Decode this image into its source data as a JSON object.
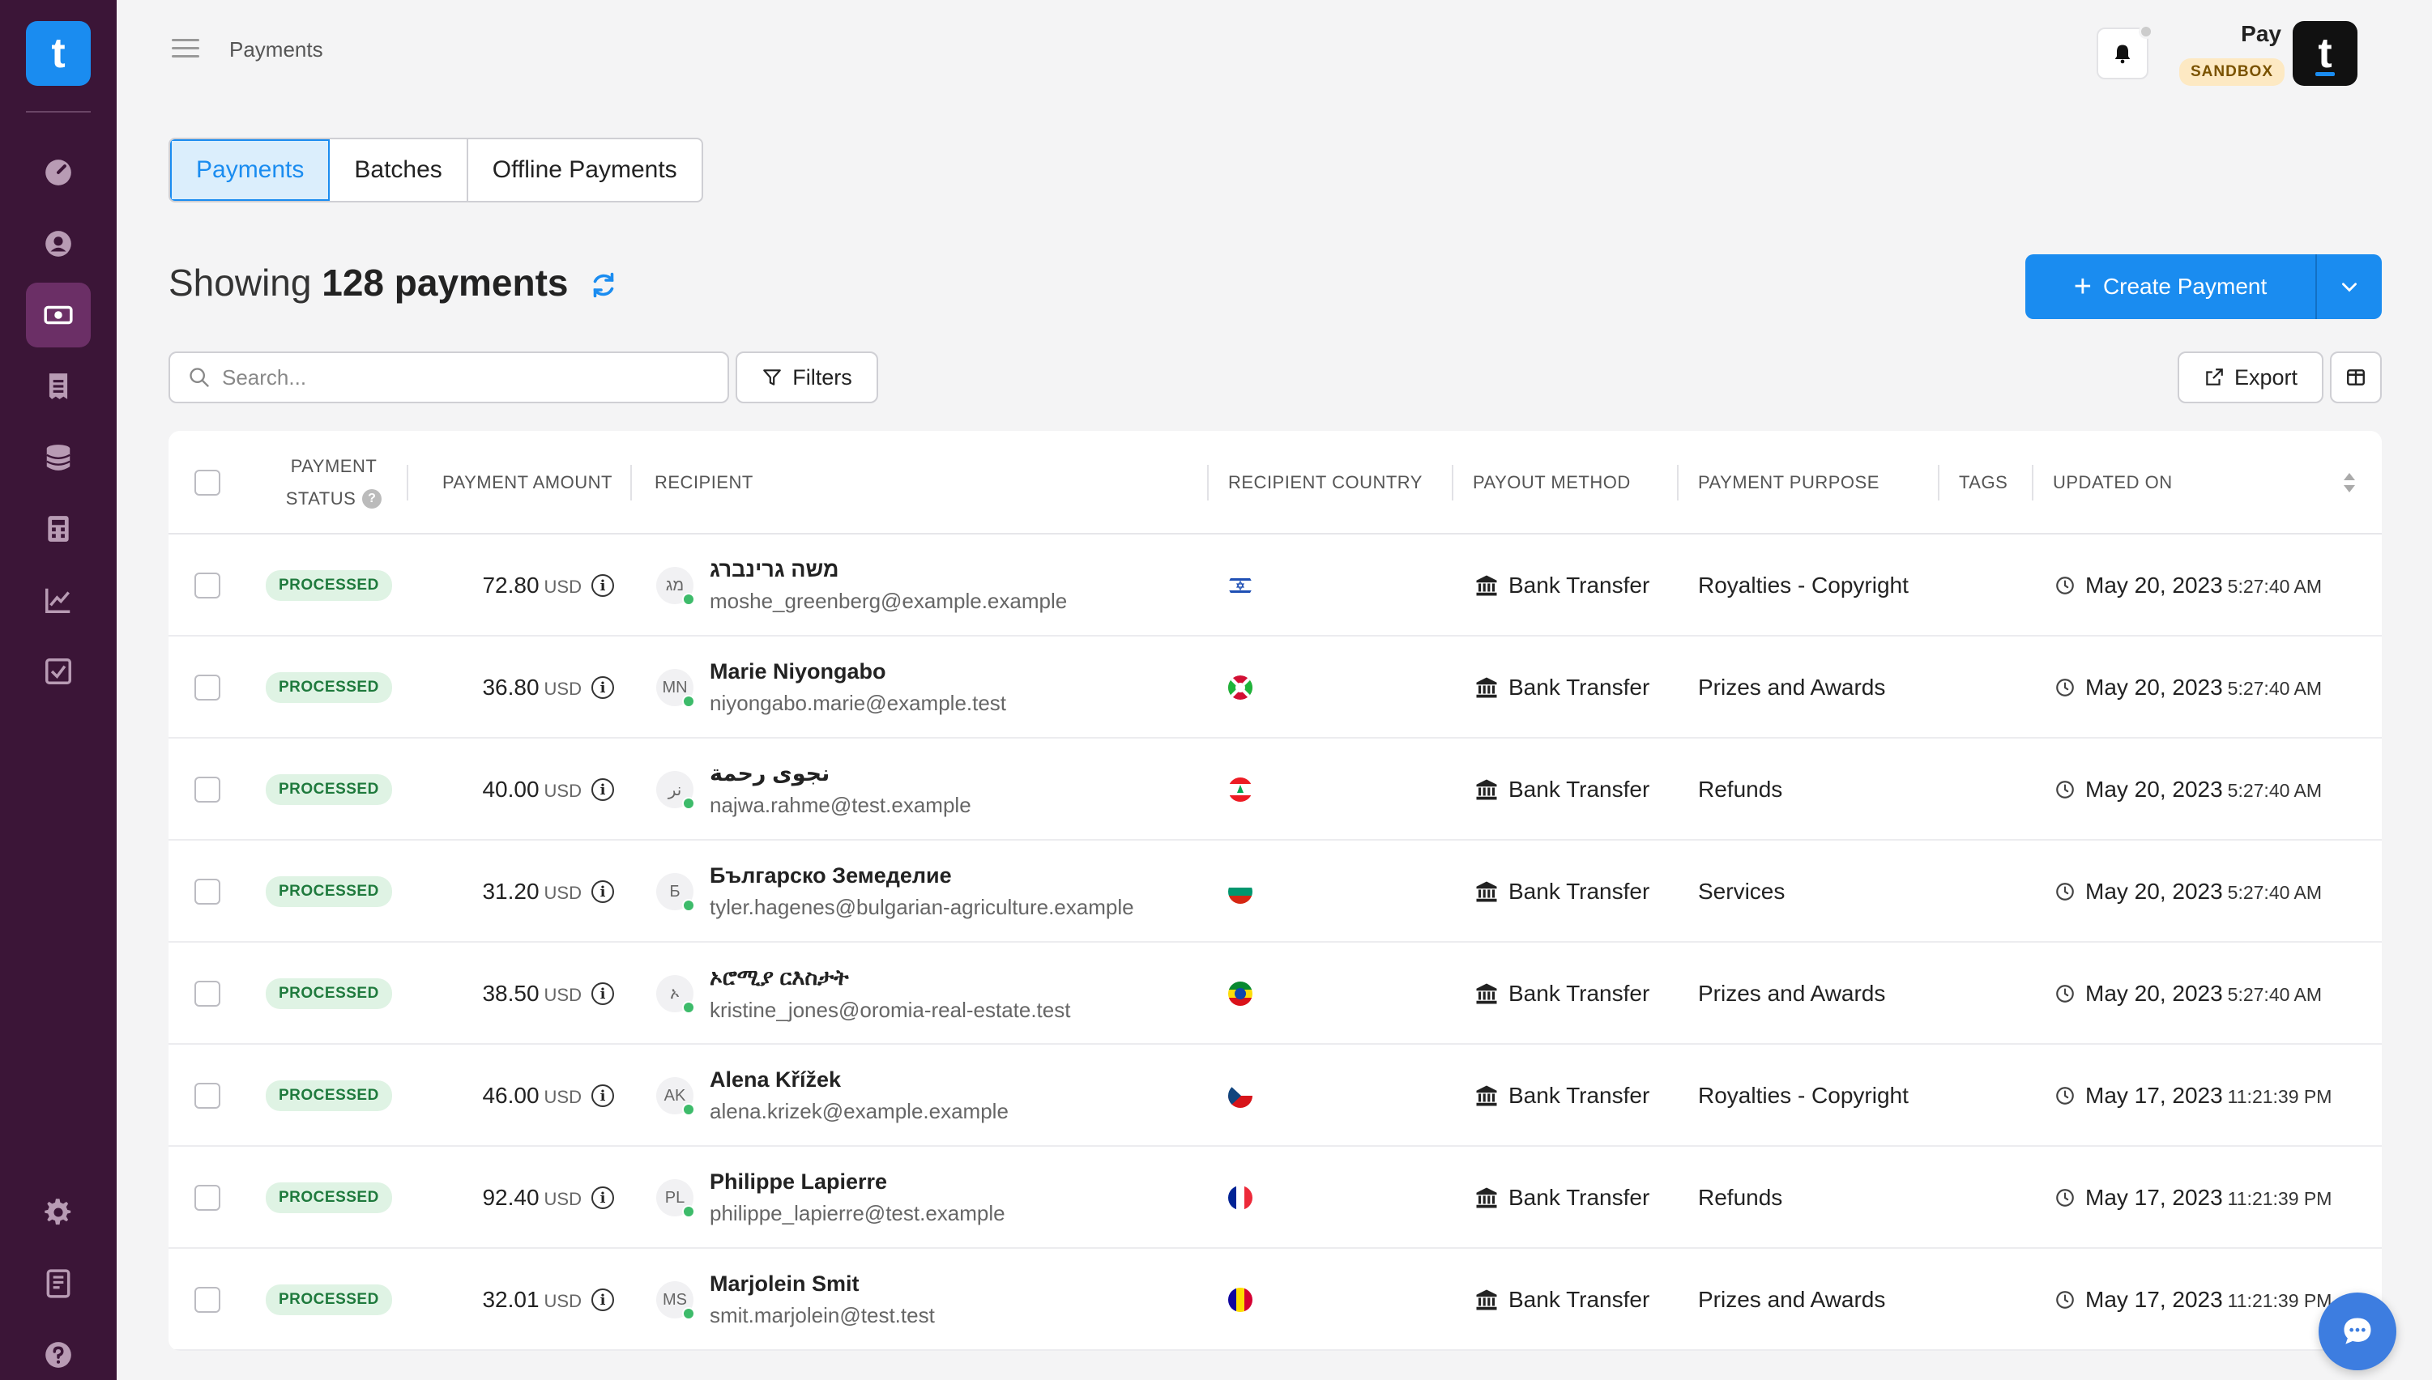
{
  "topbar": {
    "breadcrumb": "Payments",
    "pay_label": "Pay",
    "sandbox_label": "SANDBOX"
  },
  "brand": {
    "logo_letter": "t",
    "avatar_letter": "t",
    "accent": "#1a8cf0",
    "sidebar_bg": "#3b1537"
  },
  "tabs": [
    {
      "label": "Payments",
      "active": true
    },
    {
      "label": "Batches",
      "active": false
    },
    {
      "label": "Offline Payments",
      "active": false
    }
  ],
  "heading": {
    "prefix": "Showing",
    "count": "128 payments"
  },
  "actions": {
    "create_label": "Create Payment",
    "search_placeholder": "Search...",
    "filters_label": "Filters",
    "export_label": "Export"
  },
  "table": {
    "headers": {
      "status_line1": "PAYMENT",
      "status_line2": "STATUS",
      "amount": "PAYMENT AMOUNT",
      "recipient": "RECIPIENT",
      "country": "RECIPIENT COUNTRY",
      "method": "PAYOUT METHOD",
      "purpose": "PAYMENT PURPOSE",
      "tags": "TAGS",
      "updated": "UPDATED ON"
    },
    "rows": [
      {
        "status": "PROCESSED",
        "amount": "72.80",
        "currency": "USD",
        "initials": "מג",
        "name": "משה גרינברג",
        "email": "moshe_greenberg@example.example",
        "flag": "il",
        "method": "Bank Transfer",
        "purpose": "Royalties - Copyright",
        "date": "May 20, 2023",
        "time": "5:27:40 AM"
      },
      {
        "status": "PROCESSED",
        "amount": "36.80",
        "currency": "USD",
        "initials": "MN",
        "name": "Marie Niyongabo",
        "email": "niyongabo.marie@example.test",
        "flag": "bi",
        "method": "Bank Transfer",
        "purpose": "Prizes and Awards",
        "date": "May 20, 2023",
        "time": "5:27:40 AM"
      },
      {
        "status": "PROCESSED",
        "amount": "40.00",
        "currency": "USD",
        "initials": "نر",
        "name": "نجوى رحمة",
        "email": "najwa.rahme@test.example",
        "flag": "lb",
        "method": "Bank Transfer",
        "purpose": "Refunds",
        "date": "May 20, 2023",
        "time": "5:27:40 AM"
      },
      {
        "status": "PROCESSED",
        "amount": "31.20",
        "currency": "USD",
        "initials": "Б",
        "name": "Българско Земеделие",
        "email": "tyler.hagenes@bulgarian-agriculture.example",
        "flag": "bg",
        "method": "Bank Transfer",
        "purpose": "Services",
        "date": "May 20, 2023",
        "time": "5:27:40 AM"
      },
      {
        "status": "PROCESSED",
        "amount": "38.50",
        "currency": "USD",
        "initials": "ኦ",
        "name": "ኦሮሚያ ርእስታት",
        "email": "kristine_jones@oromia-real-estate.test",
        "flag": "et",
        "method": "Bank Transfer",
        "purpose": "Prizes and Awards",
        "date": "May 20, 2023",
        "time": "5:27:40 AM"
      },
      {
        "status": "PROCESSED",
        "amount": "46.00",
        "currency": "USD",
        "initials": "AK",
        "name": "Alena Křížek",
        "email": "alena.krizek@example.example",
        "flag": "cz",
        "method": "Bank Transfer",
        "purpose": "Royalties - Copyright",
        "date": "May 17, 2023",
        "time": "11:21:39 PM"
      },
      {
        "status": "PROCESSED",
        "amount": "92.40",
        "currency": "USD",
        "initials": "PL",
        "name": "Philippe Lapierre",
        "email": "philippe_lapierre@test.example",
        "flag": "fr",
        "method": "Bank Transfer",
        "purpose": "Refunds",
        "date": "May 17, 2023",
        "time": "11:21:39 PM"
      },
      {
        "status": "PROCESSED",
        "amount": "32.01",
        "currency": "USD",
        "initials": "MS",
        "name": "Marjolein Smit",
        "email": "smit.marjolein@test.test",
        "flag": "ad",
        "method": "Bank Transfer",
        "purpose": "Prizes and Awards",
        "date": "May 17, 2023",
        "time": "11:21:39 PM"
      }
    ]
  }
}
